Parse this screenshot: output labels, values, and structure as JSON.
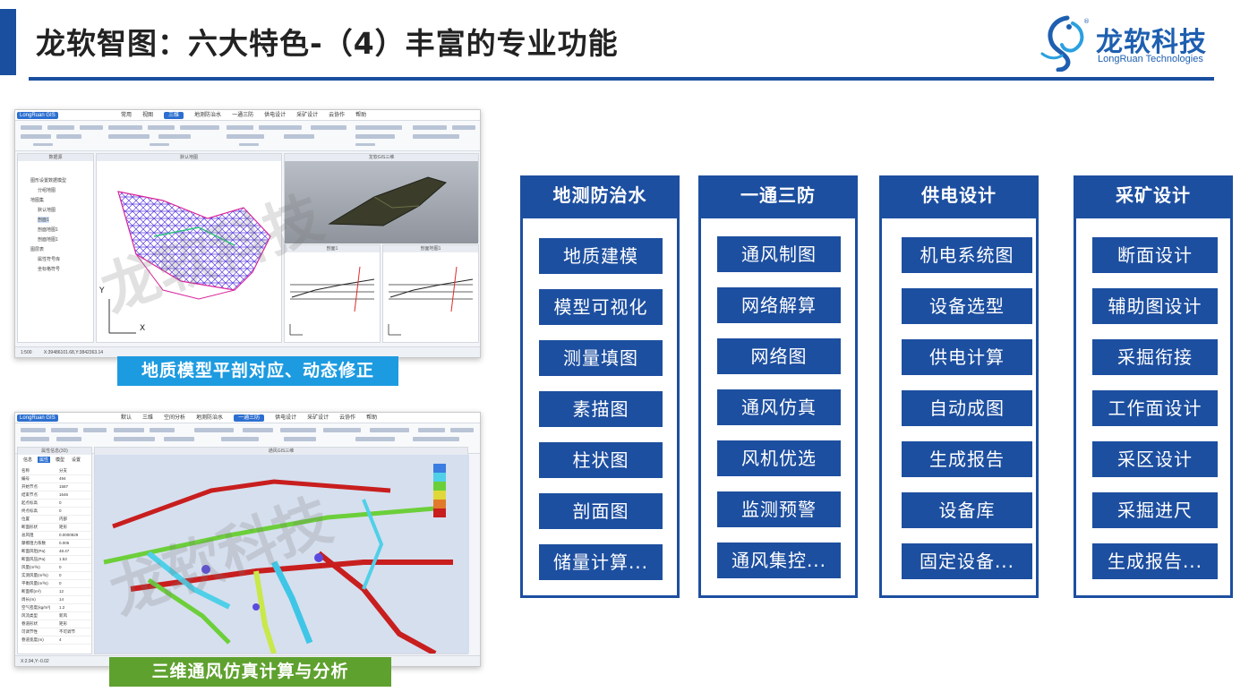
{
  "header": {
    "title": "龙软智图：六大特色-（4）丰富的专业功能",
    "logo_cn": "龙软科技",
    "logo_en": "LongRuan Technologies"
  },
  "screenshot1": {
    "app_badge": "LongRuan GIS",
    "menu": [
      "常用",
      "视图",
      "三维",
      "地测防治水",
      "一通三防",
      "供电设计",
      "采矿设计",
      "云协作",
      "帮助"
    ],
    "active_menu": "三维",
    "panels": {
      "tree_title": "数据源",
      "plan_title": "默认地图",
      "view3d_title": "龙软GIS三维",
      "section1_title": "剖面1",
      "section2_title": "剖面地图1"
    },
    "tree_items": [
      "图形设置数据模型",
      "分组地图",
      "地图集",
      "默认地图",
      "剖面1",
      "剖面地图1",
      "剖面地图1",
      "图层表",
      "属性符号库",
      "坐标格符号"
    ],
    "scale": "1:500",
    "coords": "X:39486101.68,Y:3842363.14",
    "axis_y": "Y",
    "axis_x": "X",
    "watermark": "龙软科技",
    "caption": "地质模型平剖对应、动态修正"
  },
  "screenshot2": {
    "app_badge": "LongRuan GIS",
    "menu": [
      "默认",
      "三维",
      "空间分析",
      "地测防治水",
      "一通三防",
      "供电设计",
      "采矿设计",
      "云协作",
      "帮助"
    ],
    "active_menu": "一通三防",
    "panels": {
      "prop_title": "属性信息(3D)",
      "view_title": "通风GIS三维"
    },
    "prop_tabs": [
      "信息",
      "属性",
      "模型",
      "设置"
    ],
    "prop_rows": [
      [
        "名称",
        "分支"
      ],
      [
        "编号",
        "494"
      ],
      [
        "开始节点",
        "1587"
      ],
      [
        "结束节点",
        "1646"
      ],
      [
        "起点标高",
        "0"
      ],
      [
        "终点标高",
        "0"
      ],
      [
        "位置",
        "内部"
      ],
      [
        "断面形状",
        "矩形"
      ],
      [
        "总风阻",
        "0.0000929"
      ],
      [
        "摩擦阻力系数",
        "0.005"
      ],
      [
        "断面风阻(Pa)",
        "48.47"
      ],
      [
        "断面风压(Pa)",
        "1.53"
      ],
      [
        "风量(m³/s)",
        "0"
      ],
      [
        "实测风量(m³/s)",
        "0"
      ],
      [
        "平衡风量(m³/s)",
        "0"
      ],
      [
        "断面积(m²)",
        "12"
      ],
      [
        "周长(m)",
        "14"
      ],
      [
        "空气密度(kg/m³)",
        "1.2"
      ],
      [
        "风流类型",
        "新风"
      ],
      [
        "巷道形状",
        "矩形"
      ],
      [
        "可调节性",
        "不可调节"
      ],
      [
        "巷道宽度(m)",
        "4"
      ]
    ],
    "status": "X:2.94,Y:-0.02",
    "watermark": "龙软科技",
    "caption": "三维通风仿真计算与分析"
  },
  "columns": [
    {
      "title": "地测防治水",
      "items": [
        "地质建模",
        "模型可视化",
        "测量填图",
        "素描图",
        "柱状图",
        "剖面图",
        "储量计算..."
      ]
    },
    {
      "title": "一通三防",
      "items": [
        "通风制图",
        "网络解算",
        "网络图",
        "通风仿真",
        "风机优选",
        "监测预警",
        "通风集控..."
      ]
    },
    {
      "title": "供电设计",
      "items": [
        "机电系统图",
        "设备选型",
        "供电计算",
        "自动成图",
        "生成报告",
        "设备库",
        "固定设备..."
      ]
    },
    {
      "title": "采矿设计",
      "items": [
        "断面设计",
        "辅助图设计",
        "采掘衔接",
        "工作面设计",
        "采区设计",
        "采掘进尺",
        "生成报告..."
      ]
    }
  ],
  "colors": {
    "brand_blue": "#1d4fa0",
    "caption1": "#1d9be0",
    "caption2": "#5fa12f"
  }
}
